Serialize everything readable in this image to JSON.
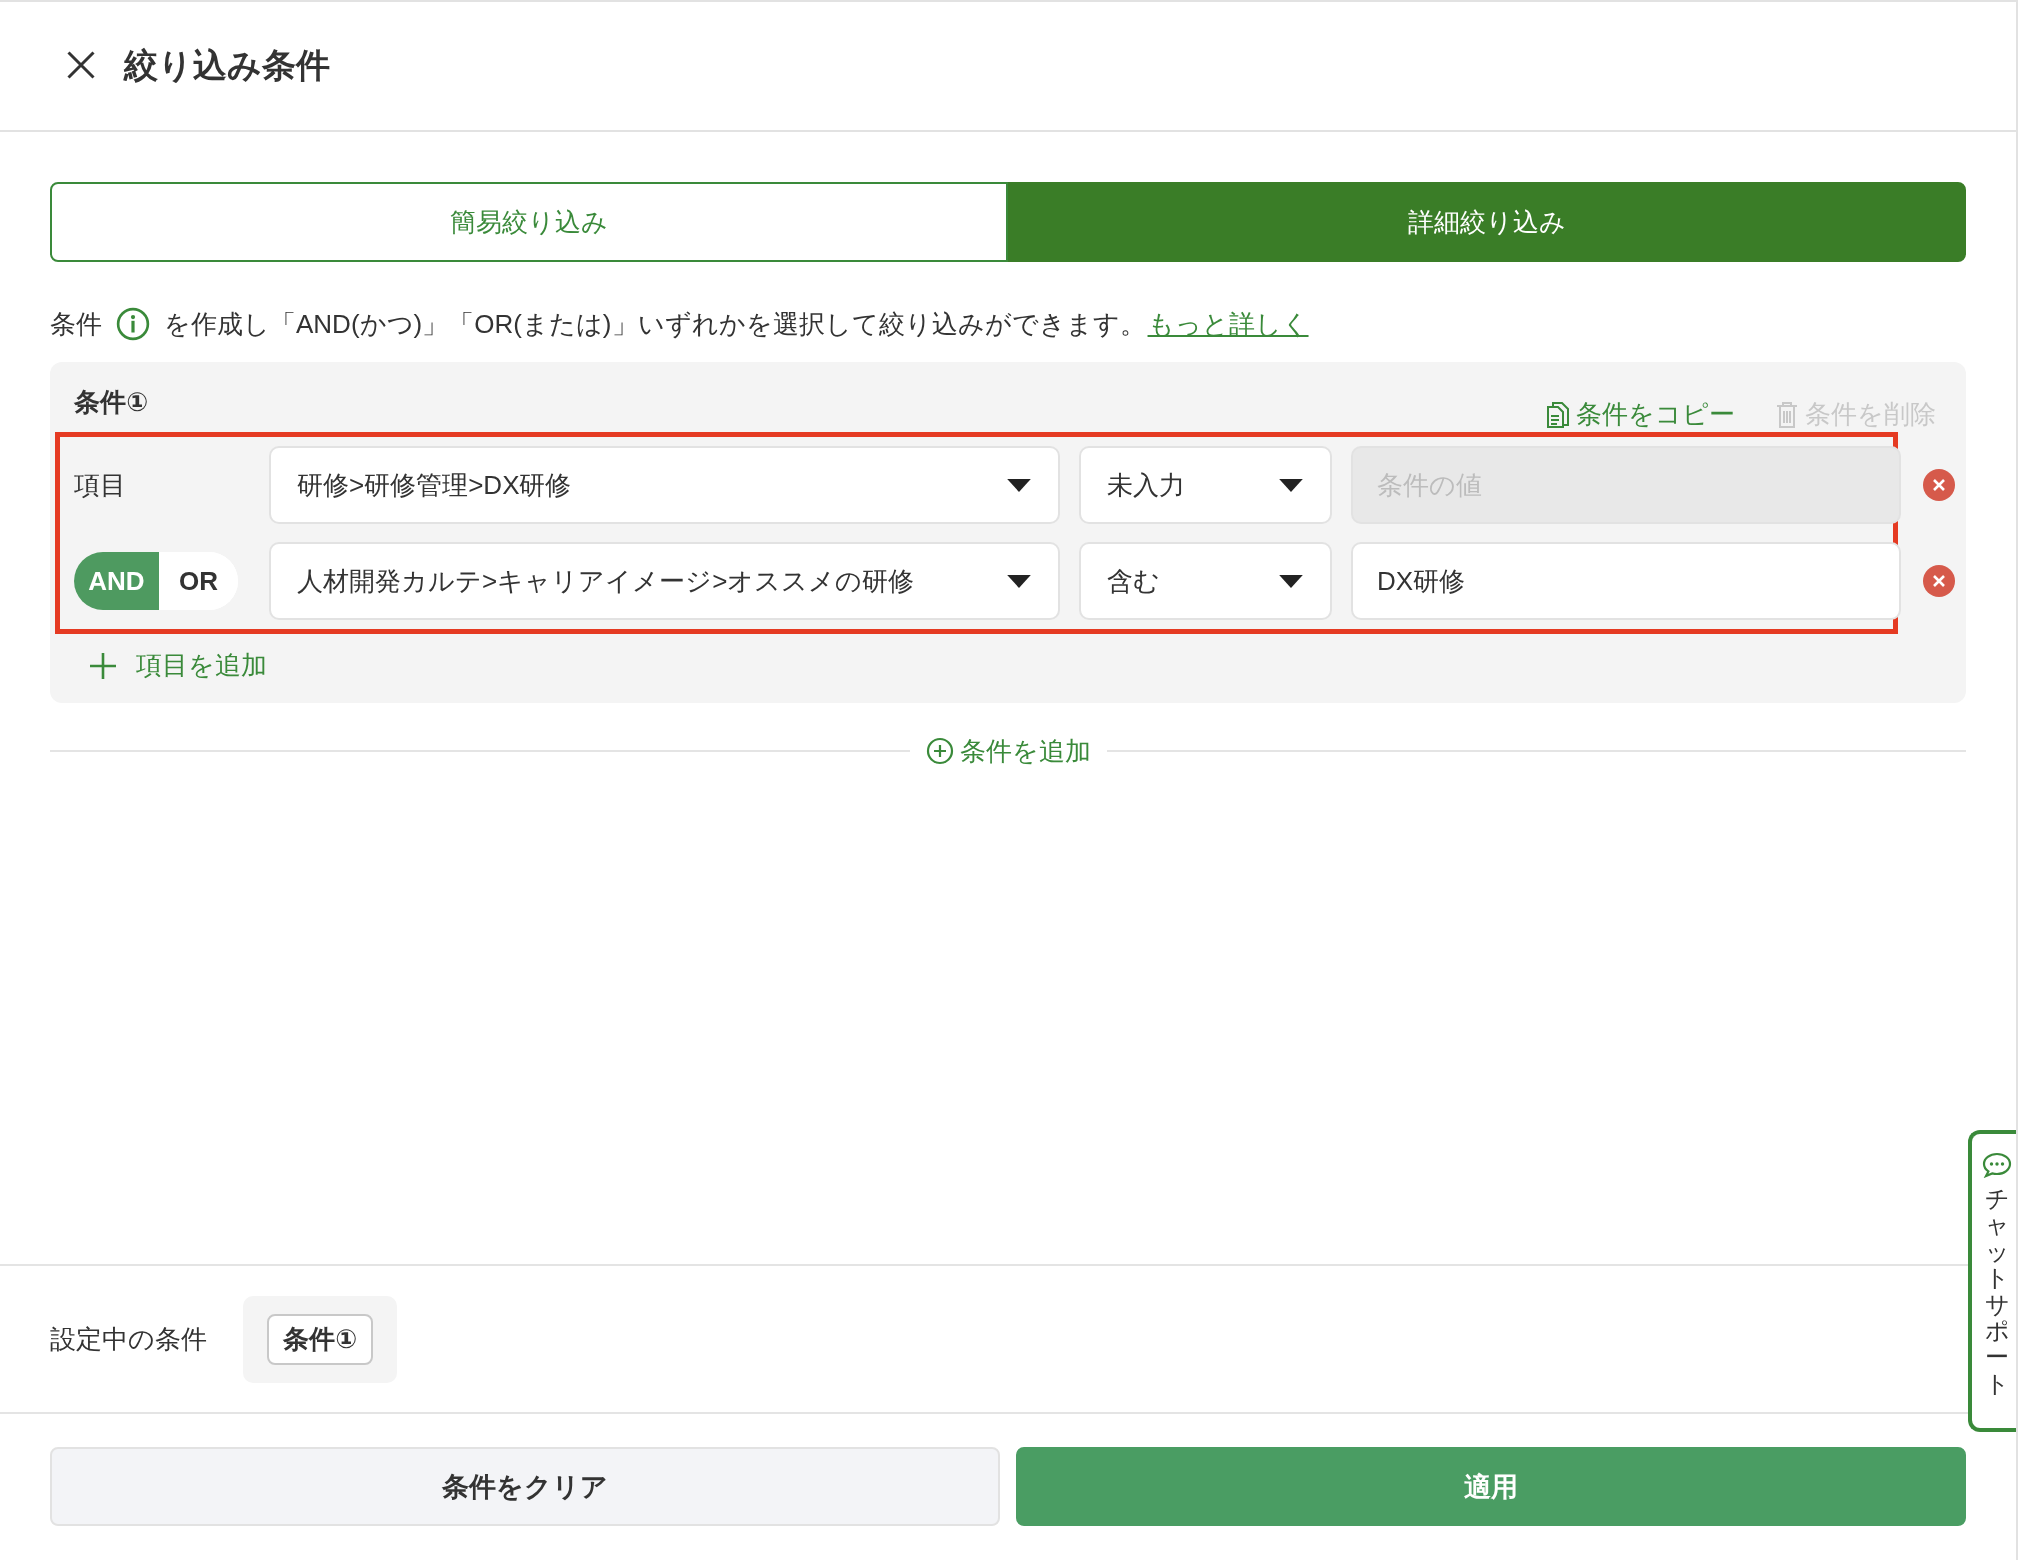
{
  "header": {
    "title": "絞り込み条件"
  },
  "tabs": [
    {
      "label": "簡易絞り込み",
      "selected": false
    },
    {
      "label": "詳細絞り込み",
      "selected": true
    }
  ],
  "description": {
    "before": "条件",
    "after": "を作成し「AND(かつ)」「OR(または)」いずれかを選択して絞り込みができます。",
    "link": "もっと詳しく"
  },
  "conditions": [
    {
      "title": "条件①",
      "copy_label": "条件をコピー",
      "delete_label": "条件を削除",
      "delete_disabled": true,
      "highlighted": true,
      "add_item_label": "項目を追加",
      "rows": [
        {
          "kind": "first",
          "label": "項目",
          "field": "研修>研修管理>DX研修",
          "operator": "未入力",
          "value_placeholder": "条件の値",
          "value_disabled": true
        },
        {
          "kind": "logic",
          "logic": [
            {
              "label": "AND",
              "selected": true
            },
            {
              "label": "OR",
              "selected": false
            }
          ],
          "field": "人材開発カルテ>キャリアイメージ>オススメの研修",
          "operator": "含む",
          "value": "DX研修",
          "value_disabled": false
        }
      ]
    }
  ],
  "add_condition_label": "条件を追加",
  "active_conditions": {
    "label": "設定中の条件",
    "chips": [
      "条件①"
    ]
  },
  "buttons": [
    {
      "kind": "secondary",
      "label": "条件をクリア"
    },
    {
      "kind": "primary",
      "label": "適用"
    }
  ],
  "chat_support": {
    "label": "チャットサポート"
  }
}
